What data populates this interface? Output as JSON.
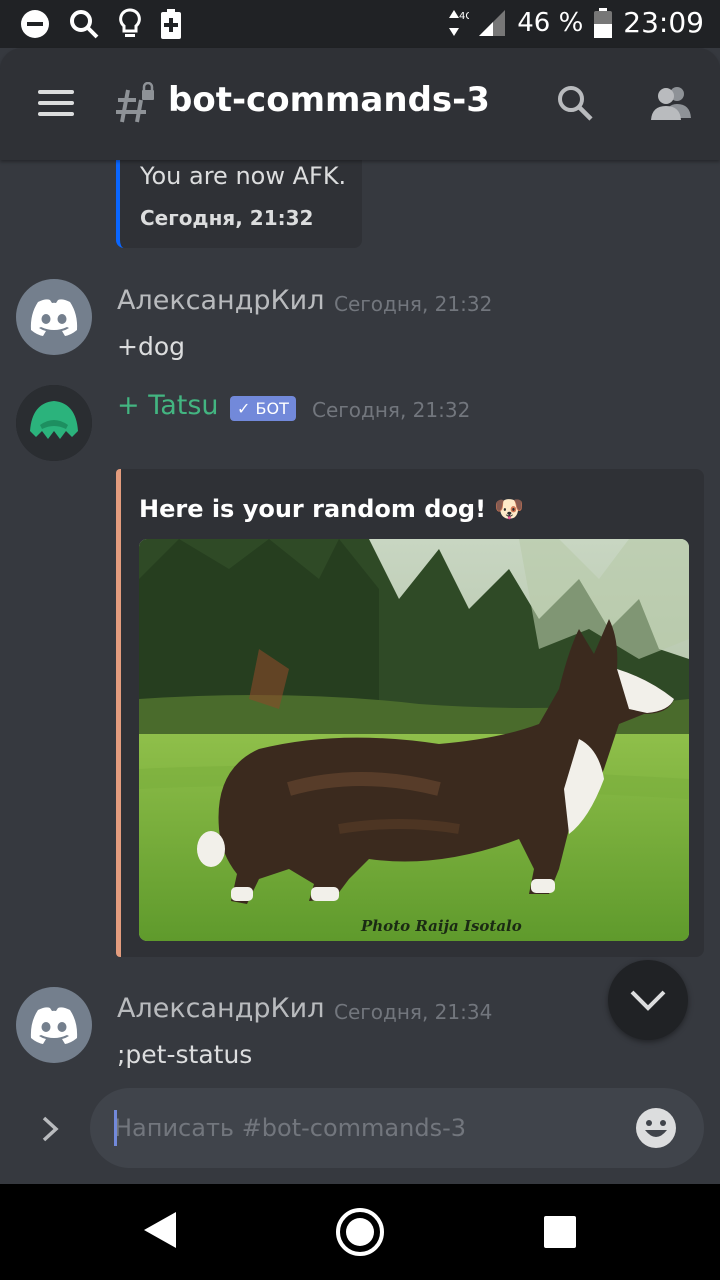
{
  "status_bar": {
    "network": "4G",
    "battery": "46 %",
    "time": "23:09",
    "icons": [
      "do-not-disturb-icon",
      "search-icon",
      "lightbulb-icon",
      "battery-saver-icon",
      "data-arrows-icon",
      "signal-icon",
      "battery-icon"
    ]
  },
  "header": {
    "channel_name": "bot-commands-3",
    "icons": [
      "menu-icon",
      "locked-channel-hash-icon",
      "search-icon",
      "members-icon"
    ]
  },
  "messages": {
    "afk_embed": {
      "text": "You are now AFK.",
      "timestamp": "Сегодня, 21:32"
    },
    "msg1": {
      "author": "АлександрКил",
      "timestamp": "Сегодня, 21:32",
      "text": "+dog"
    },
    "msg2": {
      "author": "+ Tatsu",
      "bot_tag": "✓ БОТ",
      "timestamp": "Сегодня, 21:32",
      "embed_title": "Here is your random dog! 🐶",
      "embed_image_credit": "Photo Raija Isotalo",
      "embed_color": "#e39c7e"
    },
    "msg3": {
      "author": "АлександрКил",
      "timestamp": "Сегодня, 21:34",
      "text": ";pet-status"
    }
  },
  "composer": {
    "placeholder": "Написать #bot-commands-3",
    "value": ""
  },
  "colors": {
    "background": "#36393f",
    "header": "#2f3136",
    "bot_name": "#43b581",
    "bot_tag": "#7289da",
    "afk_bar": "#0a66ff"
  }
}
